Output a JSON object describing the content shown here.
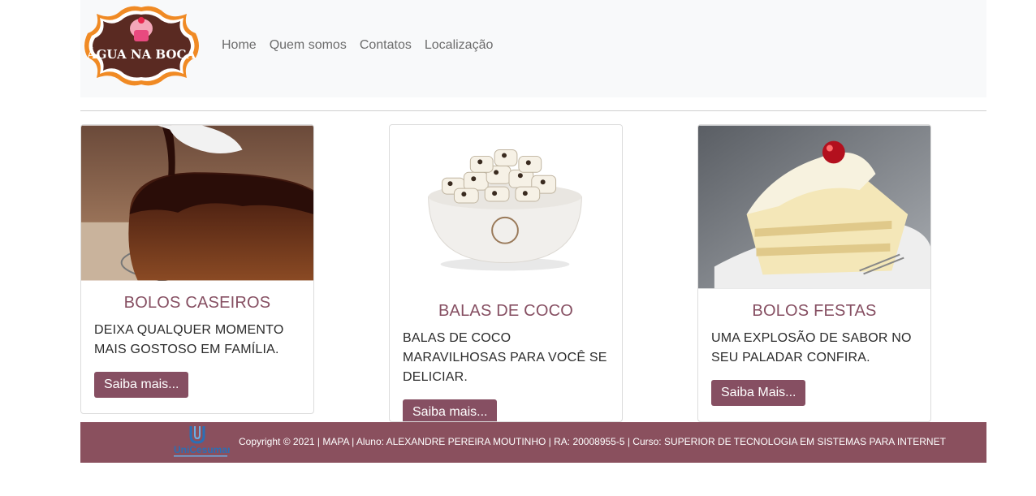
{
  "brand": {
    "logo_text": "ÁGUA NA BOCA"
  },
  "nav": {
    "items": [
      "Home",
      "Quem somos",
      "Contatos",
      "Localização"
    ]
  },
  "cards": [
    {
      "title": "BOLOS CASEIROS",
      "text": "DEIXA QUALQUER MOMENTO MAIS GOSTOSO EM FAMÍLIA.",
      "button": "Saiba mais..."
    },
    {
      "title": "BALAS DE COCO",
      "text": "BALAS DE COCO MARAVILHOSAS PARA VOCÊ SE DELICIAR.",
      "button": "Saiba mais..."
    },
    {
      "title": "BOLOS FESTAS",
      "text": "UMA EXPLOSÃO DE SABOR NO SEU PALADAR CONFIRA.",
      "button": "Saiba Mais..."
    }
  ],
  "footer": {
    "logo_text": "UniCesumar",
    "text": "Copyright © 2021 | MAPA | Aluno: ALEXANDRE PEREIRA MOUTINHO | RA: 20008955-5 | Curso: SUPERIOR DE TECNOLOGIA EM SISTEMAS PARA INTERNET"
  },
  "colors": {
    "accent": "#864f62",
    "footer": "#8a505e",
    "navbar": "#f8f9fa"
  }
}
